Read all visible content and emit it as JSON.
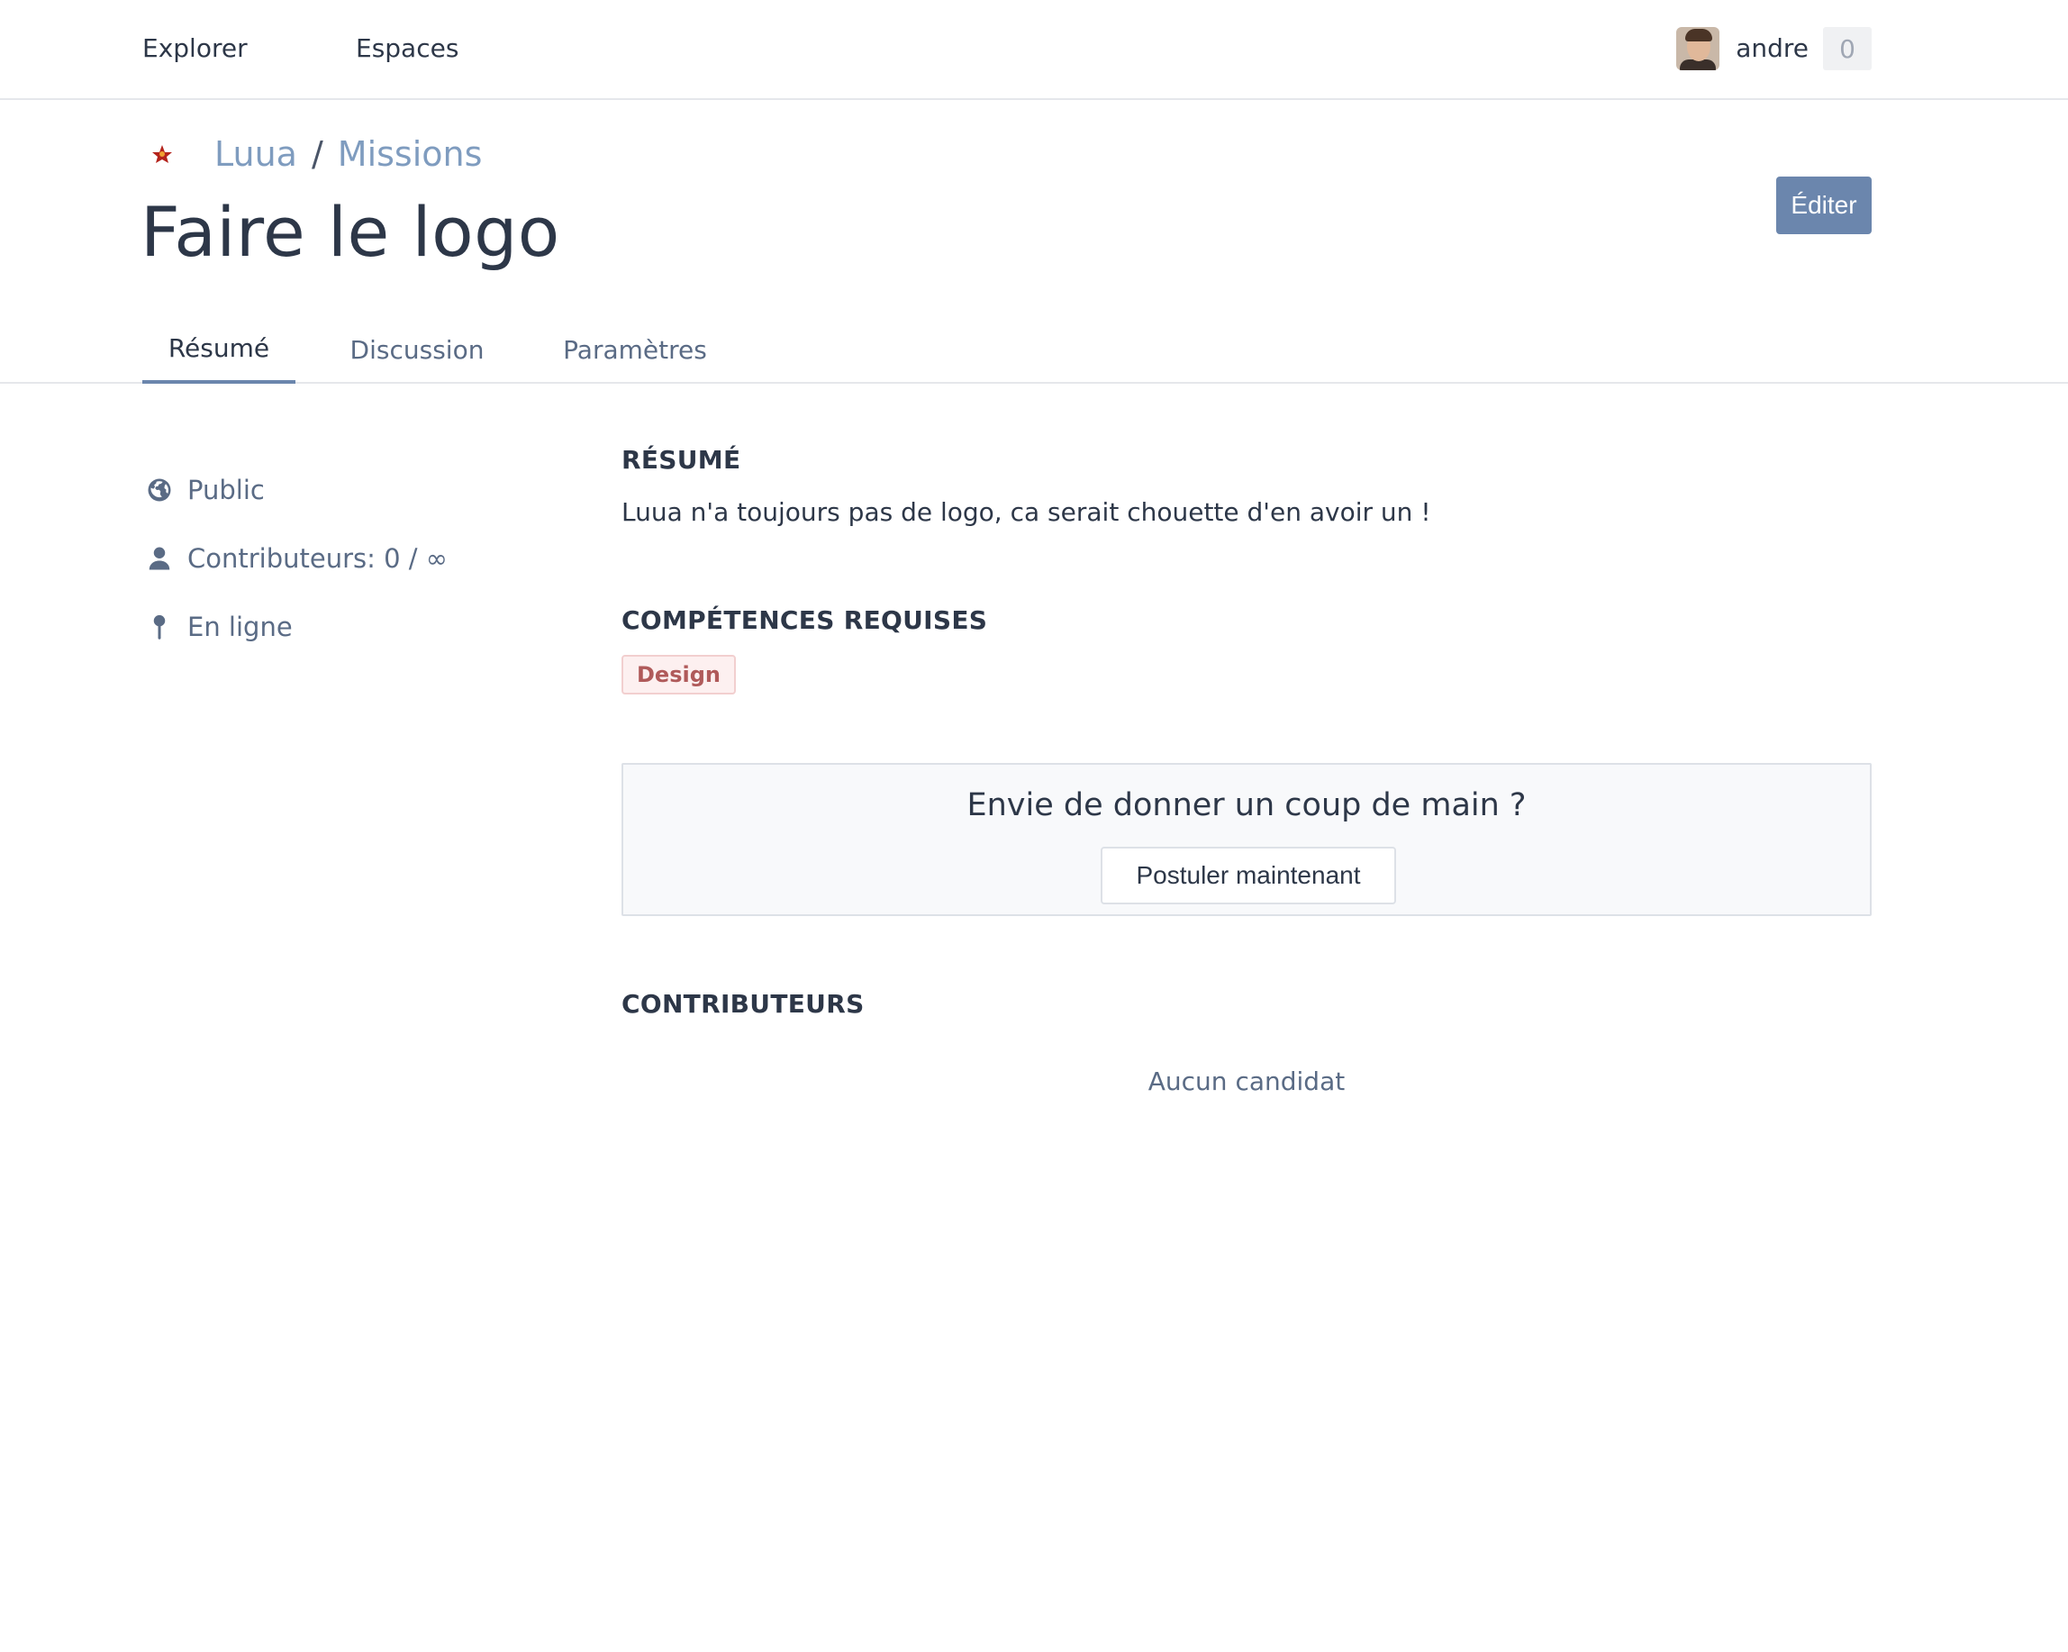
{
  "navbar": {
    "explorer": "Explorer",
    "espaces": "Espaces",
    "username": "andre",
    "notification_count": "0"
  },
  "header": {
    "breadcrumb": {
      "space": "Luua",
      "separator": "/",
      "section": "Missions"
    },
    "title": "Faire le logo",
    "edit_label": "Éditer"
  },
  "tabs": [
    {
      "label": "Résumé",
      "active": true
    },
    {
      "label": "Discussion",
      "active": false
    },
    {
      "label": "Paramètres",
      "active": false
    }
  ],
  "sidebar": {
    "visibility": "Public",
    "contributors": "Contributeurs: 0 / ∞",
    "location": "En ligne",
    "icons": [
      "globe-icon",
      "user-icon",
      "pin-icon"
    ]
  },
  "main": {
    "summary_heading": "RÉSUMÉ",
    "summary_text": "Luua n'a toujours pas de logo, ca serait chouette d'en avoir un !",
    "skills_heading": "COMPÉTENCES REQUISES",
    "skills": [
      "Design"
    ],
    "help_title": "Envie de donner un coup de main ?",
    "apply_label": "Postuler maintenant",
    "contributors_heading": "CONTRIBUTEURS",
    "no_candidate": "Aucun candidat"
  },
  "colors": {
    "accent": "#6b86ad",
    "link": "#7f9cbf",
    "text": "#2d3748",
    "muted": "#5a6b85",
    "badge_text": "#b05a5a"
  }
}
